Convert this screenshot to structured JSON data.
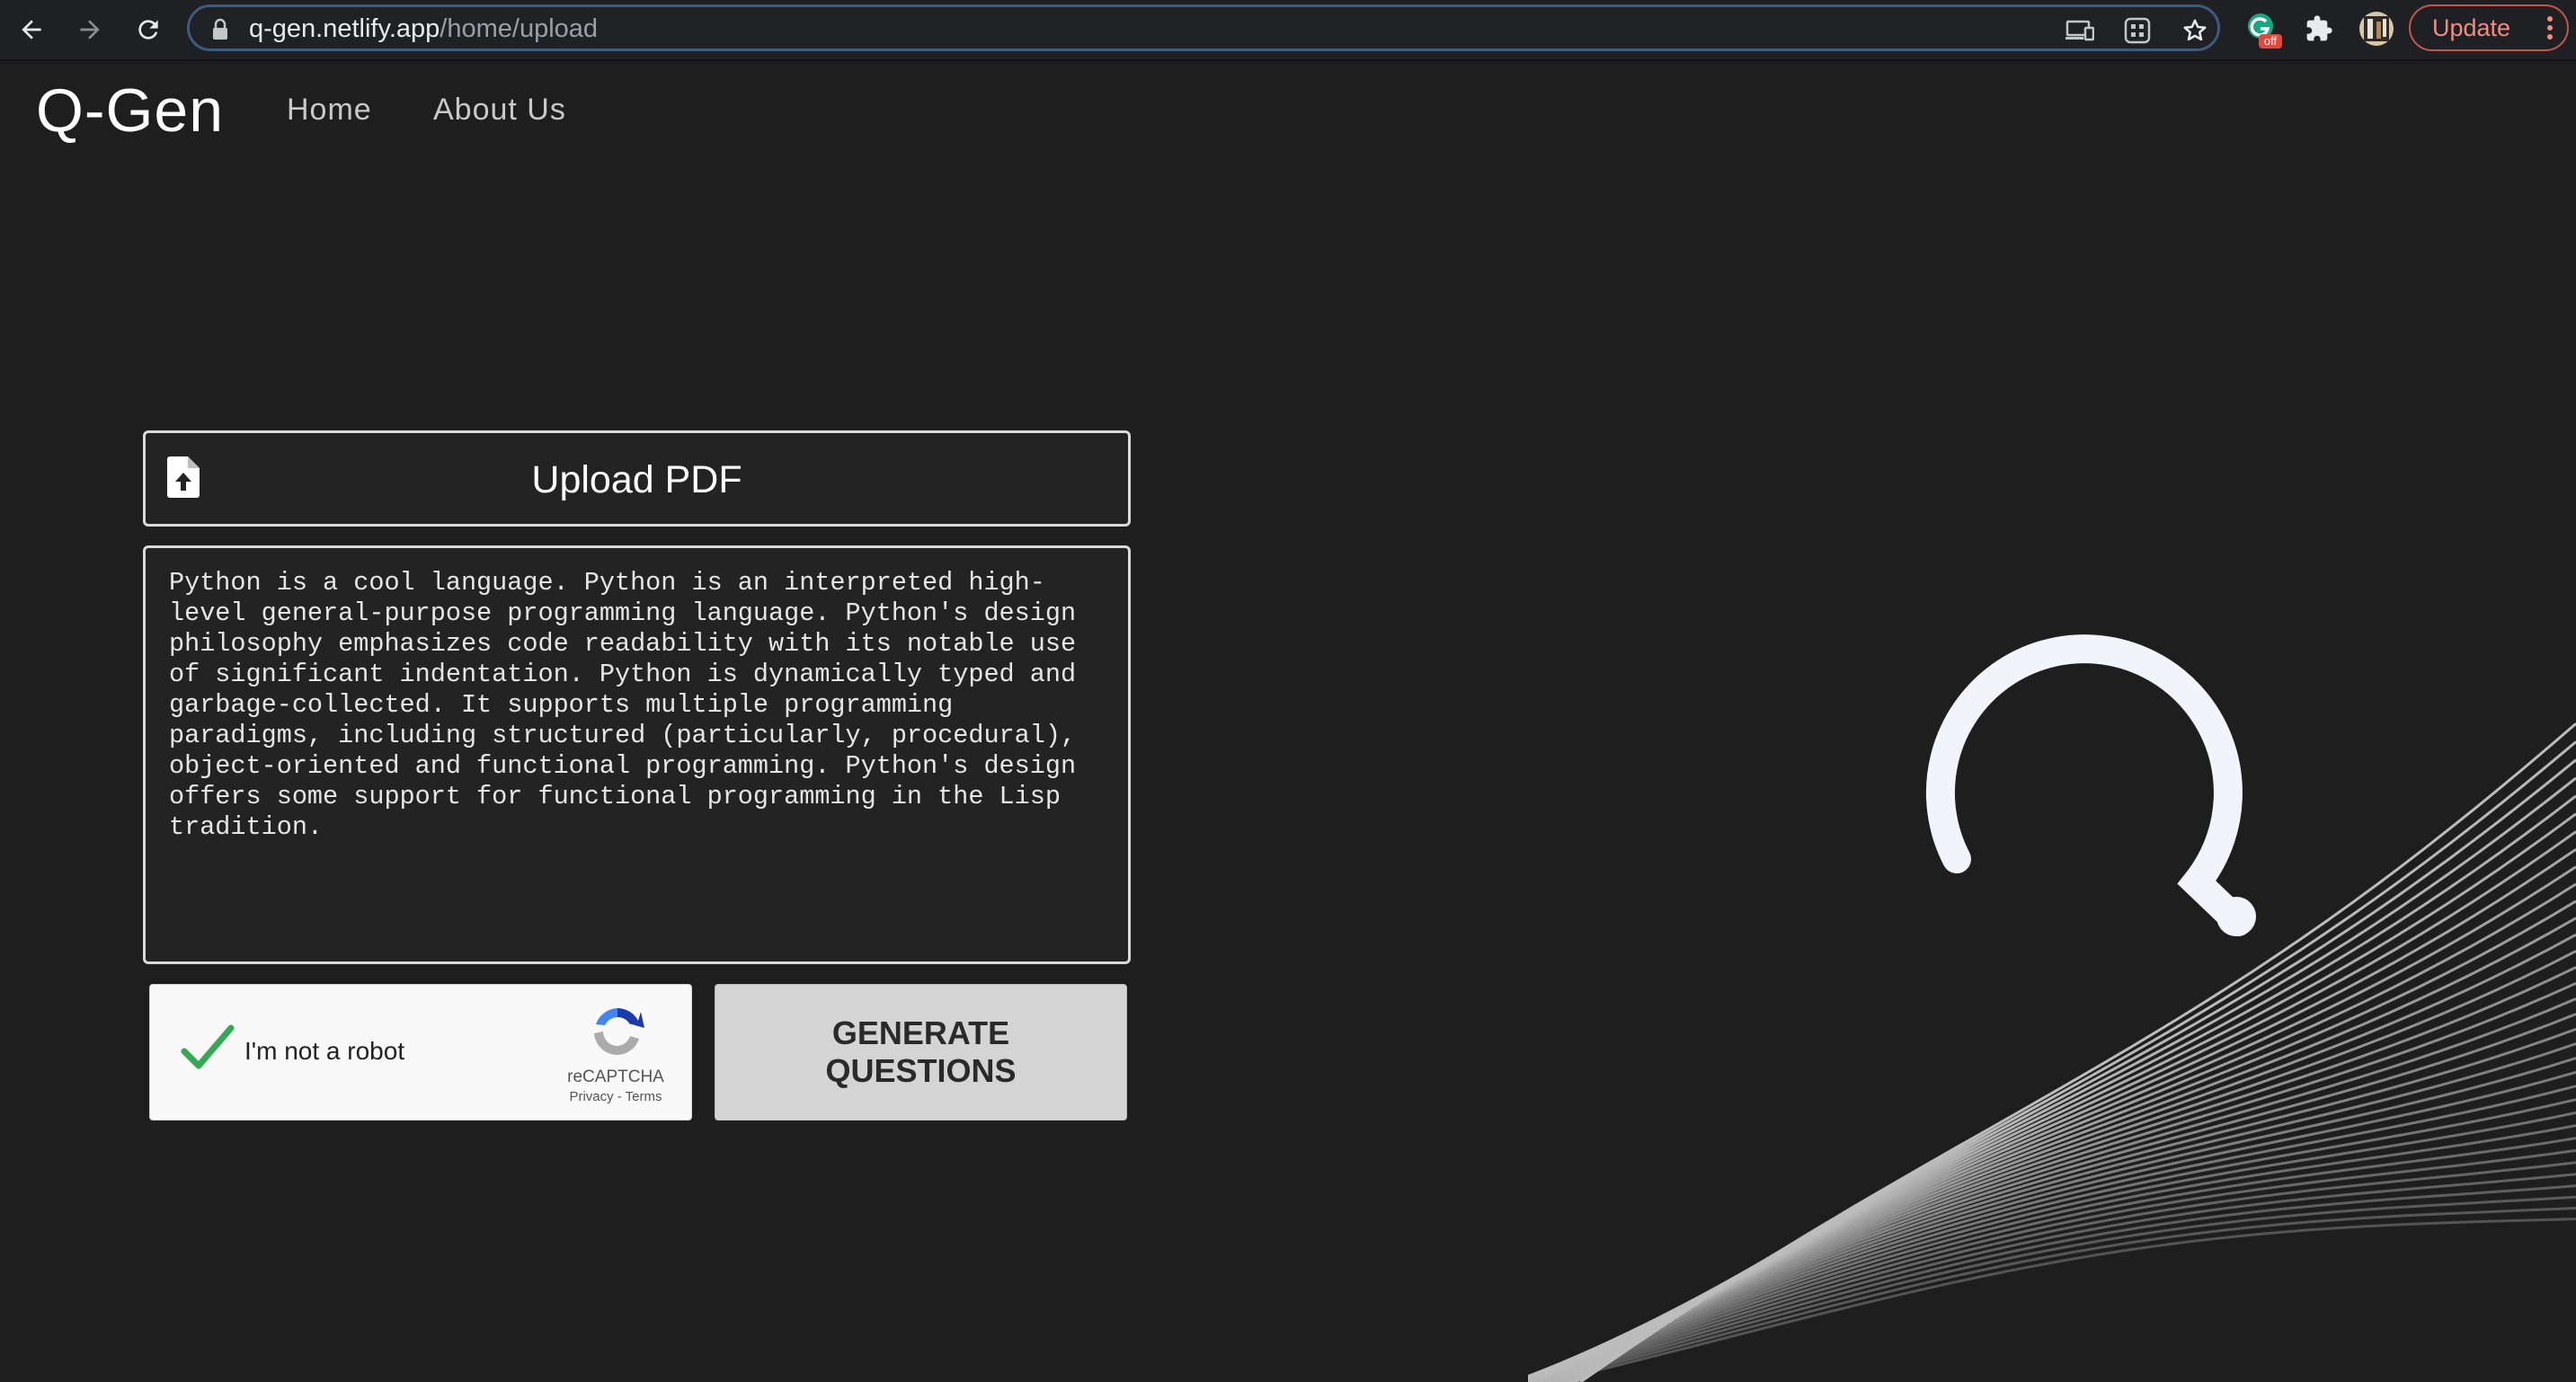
{
  "browser": {
    "url_host": "q-gen.netlify.app",
    "url_path": "/home/upload",
    "update_label": "Update",
    "extension_badge": "off",
    "icons": [
      "back-icon",
      "forward-icon",
      "reload-icon",
      "lock-icon",
      "cast-icon",
      "qr-code-icon",
      "bookmark-star-icon",
      "grammarly-icon",
      "extensions-puzzle-icon",
      "profile-avatar",
      "more-vert-icon"
    ]
  },
  "site": {
    "logo": "Q-Gen",
    "nav": [
      {
        "label": "Home"
      },
      {
        "label": "About Us"
      }
    ]
  },
  "upload": {
    "label": "Upload PDF",
    "icon": "file-upload-icon"
  },
  "text_input": {
    "value": "Python is a cool language. Python is an interpreted high-level general-purpose programming language. Python's design philosophy emphasizes code readability with its notable use of significant indentation. Python is dynamically typed and garbage-collected. It supports multiple programming paradigms, including structured (particularly, procedural), object-oriented and functional programming. Python's design offers some support for functional programming in the Lisp tradition."
  },
  "recaptcha": {
    "label": "I'm not a robot",
    "checked": true,
    "brand": "reCAPTCHA",
    "links": "Privacy - Terms"
  },
  "generate_button": {
    "label": "GENERATE QUESTIONS"
  },
  "decoration": {
    "icon": "question-mark-icon",
    "background": "wave-lines-art"
  },
  "colors": {
    "page_bg": "#1e1e1e",
    "accent_check": "#34a853",
    "update_red": "#f28b82",
    "omnibox_border": "#3d5a80"
  }
}
